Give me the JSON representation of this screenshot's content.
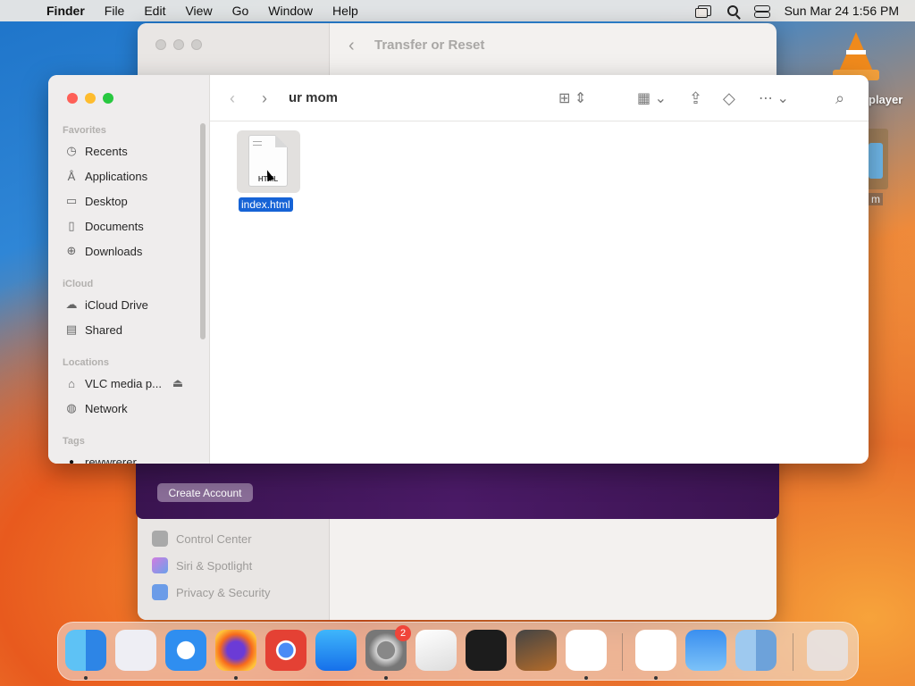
{
  "menubar": {
    "app": "Finder",
    "menus": [
      "File",
      "Edit",
      "View",
      "Go",
      "Window",
      "Help"
    ],
    "clock": "Sun Mar 24  1:56 PM"
  },
  "desktop": {
    "vlc_label": "player",
    "item2_label": "m"
  },
  "back_window": {
    "title": "Transfer or Reset",
    "create_button": "Create Account",
    "sidebar_items": [
      {
        "label": "Control Center",
        "color": "#9a9a9a"
      },
      {
        "label": "Siri & Spotlight",
        "color": "#c77ad8"
      },
      {
        "label": "Privacy & Security",
        "color": "#5b8fe0"
      }
    ]
  },
  "finder": {
    "path_title": "ur mom",
    "sections": {
      "favorites": "Favorites",
      "icloud": "iCloud",
      "locations": "Locations",
      "tags": "Tags"
    },
    "favorites": [
      {
        "label": "Recents",
        "icon": "clock-icon",
        "glyph": "◷"
      },
      {
        "label": "Applications",
        "icon": "applications-icon",
        "glyph": "Å"
      },
      {
        "label": "Desktop",
        "icon": "desktop-icon",
        "glyph": "▭"
      },
      {
        "label": "Documents",
        "icon": "document-icon",
        "glyph": "▯"
      },
      {
        "label": "Downloads",
        "icon": "download-icon",
        "glyph": "⊕"
      }
    ],
    "icloud": [
      {
        "label": "iCloud Drive",
        "icon": "cloud-icon",
        "glyph": "☁"
      },
      {
        "label": "Shared",
        "icon": "shared-folder-icon",
        "glyph": "▤"
      }
    ],
    "locations": [
      {
        "label": "VLC media p...",
        "icon": "disk-icon",
        "glyph": "⌂"
      },
      {
        "label": "Network",
        "icon": "globe-icon",
        "glyph": "◍"
      }
    ],
    "tags": [
      {
        "label": "rewwrerer",
        "icon": "tag-dot-icon",
        "glyph": "●"
      }
    ],
    "file": {
      "name": "index.html",
      "type_label": "HTML"
    }
  },
  "dock": {
    "settings_badge": "2"
  }
}
